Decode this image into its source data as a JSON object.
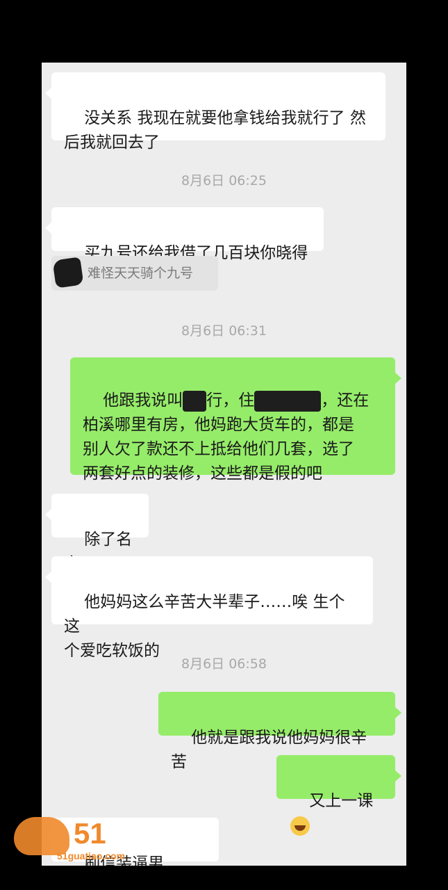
{
  "messages": [
    {
      "kind": "in",
      "text": "没关系 我现在就要他拿钱给我就行了 然\n后我就回去了"
    },
    {
      "kind": "time",
      "text": "8月6日 06:25"
    },
    {
      "kind": "in",
      "text": "买九号还给我借了几百块你晓得"
    },
    {
      "kind": "quote",
      "text": "难怪天天骑个九号"
    },
    {
      "kind": "time",
      "text": "8月6日 06:31"
    },
    {
      "kind": "out",
      "segments": [
        "他跟我说叫",
        "行，住",
        "，还在\n柏溪哪里有房，他妈跑大货车的，都是\n别人欠了款还不上抵给他们几套，选了\n两套好点的装修，这些都是假的吧"
      ]
    },
    {
      "kind": "in",
      "text": "除了名字"
    },
    {
      "kind": "in",
      "text": "他妈妈这么辛苦大半辈子……唉 生个这\n个爱吃软饭的"
    },
    {
      "kind": "time",
      "text": "8月6日 06:58"
    },
    {
      "kind": "out",
      "text": "他就是跟我说他妈妈很辛苦"
    },
    {
      "kind": "out",
      "text": "又上一课",
      "emoji": "laughing-crying-emoji"
    },
    {
      "kind": "in",
      "text": "刷信装逼男"
    }
  ],
  "watermark": {
    "number": "51",
    "url": "51guatiao.com"
  }
}
